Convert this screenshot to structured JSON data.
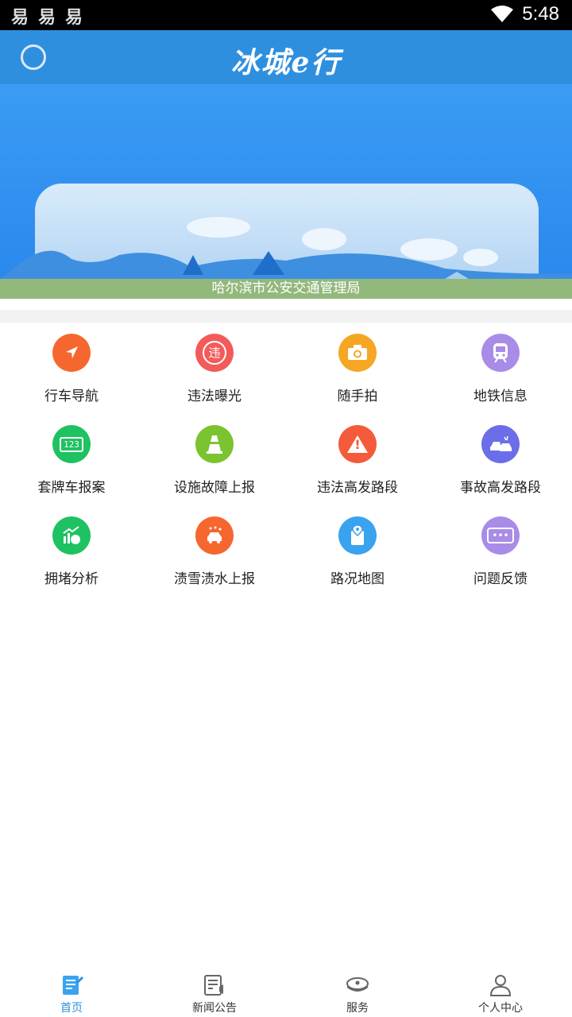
{
  "status_bar": {
    "left_icons": [
      "易",
      "易",
      "易"
    ],
    "time": "5:48"
  },
  "header": {
    "title": "冰城e行"
  },
  "banner": {
    "caption": "哈尔滨市公安交通管理局"
  },
  "grid": [
    {
      "label": "行车导航",
      "icon": "navigation-arrow-icon",
      "color": "#f5672f"
    },
    {
      "label": "违法曝光",
      "icon": "violation-icon",
      "color": "#f35b5b",
      "glyph": "违"
    },
    {
      "label": "随手拍",
      "icon": "camera-icon",
      "color": "#f5a623"
    },
    {
      "label": "地铁信息",
      "icon": "metro-train-icon",
      "color": "#a88ce8"
    },
    {
      "label": "套牌车报案",
      "icon": "license-plate-icon",
      "color": "#1ec261",
      "glyph": "123"
    },
    {
      "label": "设施故障上报",
      "icon": "traffic-cone-icon",
      "color": "#7cc330"
    },
    {
      "label": "违法高发路段",
      "icon": "warning-icon",
      "color": "#f35b3a",
      "glyph": "!"
    },
    {
      "label": "事故高发路段",
      "icon": "car-accident-icon",
      "color": "#6b6ee8"
    },
    {
      "label": "拥堵分析",
      "icon": "congestion-chart-icon",
      "color": "#1ec261"
    },
    {
      "label": "渍雪渍水上报",
      "icon": "snow-car-icon",
      "color": "#f5672f"
    },
    {
      "label": "路况地图",
      "icon": "road-map-icon",
      "color": "#3aa3ef"
    },
    {
      "label": "问题反馈",
      "icon": "feedback-chat-icon",
      "color": "#a88ce8",
      "glyph": "•••"
    }
  ],
  "tabs": [
    {
      "label": "首页",
      "icon": "home-doc-icon",
      "active": true
    },
    {
      "label": "新闻公告",
      "icon": "news-icon",
      "active": false
    },
    {
      "label": "服务",
      "icon": "police-cap-icon",
      "active": false
    },
    {
      "label": "个人中心",
      "icon": "user-icon",
      "active": false
    }
  ],
  "colors": {
    "header": "#2f8fdf",
    "active_tab": "#2f8fdf"
  }
}
